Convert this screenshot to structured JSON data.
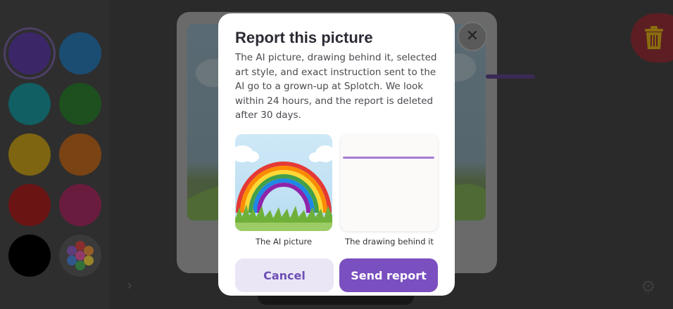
{
  "palette": {
    "colors": [
      "#3b2768",
      "#1b4d73",
      "#115f62",
      "#1d4f1f",
      "#7e6511",
      "#7a4314",
      "#6b1414",
      "#6a1c3e",
      "#000000"
    ],
    "selected_index": 0,
    "rainbow_colors": [
      "#cc2222",
      "#e07b1a",
      "#e8c21b",
      "#2a9d3a",
      "#2c6fd1",
      "#7a3fb3",
      "#d63a8c"
    ]
  },
  "dialog": {
    "title": "Report this picture",
    "body": "The AI picture, drawing behind it, selected art style, and exact instruction sent to the AI go to a grown-up at Splotch. We look within 24 hours, and the report is deleted after 30 days.",
    "ai_caption": "The AI picture",
    "drawing_caption": "The drawing behind it",
    "cancel_label": "Cancel",
    "send_label": "Send report",
    "accent": "#7a4fbf"
  },
  "toolbar": {
    "close_label": "✕"
  }
}
